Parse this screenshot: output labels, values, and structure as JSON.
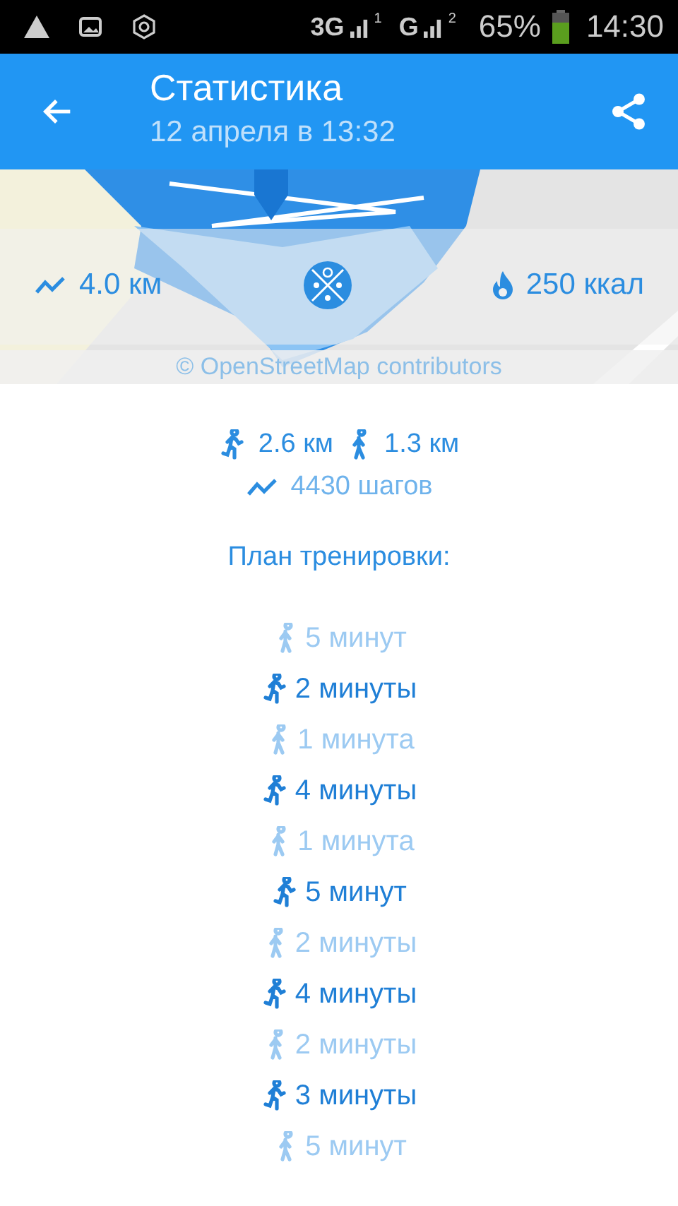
{
  "status_bar": {
    "networks": [
      {
        "label": "3G",
        "sim": "1"
      },
      {
        "label": "G",
        "sim": "2"
      }
    ],
    "battery": "65%",
    "time": "14:30"
  },
  "header": {
    "title": "Статистика",
    "subtitle": "12 апреля в 13:32"
  },
  "map": {
    "kind": "picture",
    "distance": "4.0 км",
    "calories": "250 ккал",
    "attribution": "© OpenStreetMap contributors"
  },
  "summary": {
    "run_distance": "2.6 км",
    "walk_distance": "1.3 км",
    "steps": "4430 шагов"
  },
  "plan": {
    "title": "План тренировки:",
    "items": [
      {
        "kind": "walk",
        "label": "5 минут"
      },
      {
        "kind": "run",
        "label": "2 минуты"
      },
      {
        "kind": "walk",
        "label": "1 минута"
      },
      {
        "kind": "run",
        "label": "4 минуты"
      },
      {
        "kind": "walk",
        "label": "1 минута"
      },
      {
        "kind": "run",
        "label": "5 минут"
      },
      {
        "kind": "walk",
        "label": "2 минуты"
      },
      {
        "kind": "run",
        "label": "4 минуты"
      },
      {
        "kind": "walk",
        "label": "2 минуты"
      },
      {
        "kind": "run",
        "label": "3 минуты"
      },
      {
        "kind": "walk",
        "label": "5 минут"
      }
    ]
  }
}
